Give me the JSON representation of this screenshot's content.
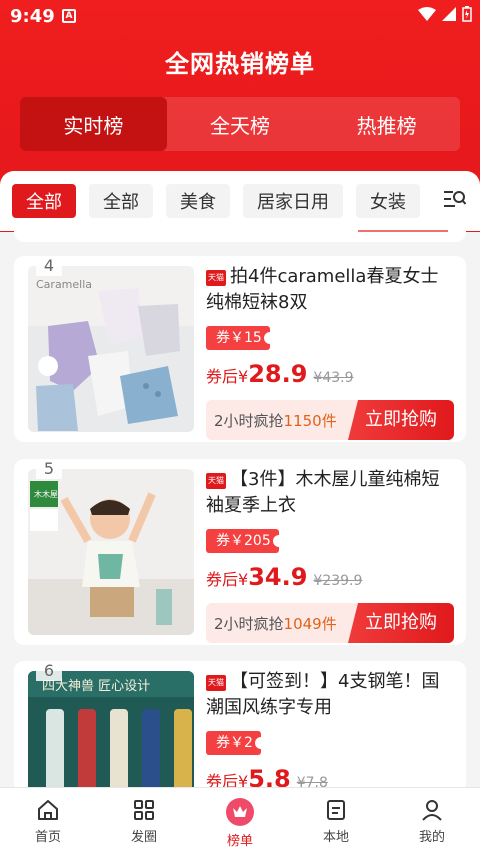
{
  "status": {
    "time": "9:49",
    "notif": "A"
  },
  "page": {
    "title": "全网热销榜单"
  },
  "tabs": [
    {
      "label": "实时榜",
      "active": true
    },
    {
      "label": "全天榜",
      "active": false
    },
    {
      "label": "热推榜",
      "active": false
    }
  ],
  "categories": [
    {
      "label": "全部",
      "active": true
    },
    {
      "label": "全部",
      "active": false
    },
    {
      "label": "美食",
      "active": false
    },
    {
      "label": "居家日用",
      "active": false
    },
    {
      "label": "女装",
      "active": false
    }
  ],
  "products": [
    {
      "rank": "4",
      "title": "拍4件caramella春夏女士纯棉短袜8双",
      "coupon": "券￥15",
      "price_label": "券后¥",
      "price": "28.9",
      "orig_price": "¥43.9",
      "sold_prefix": "2小时疯抢",
      "sold_count": "1150件",
      "buy_label": "立即抢购",
      "brand_text": "Caramella"
    },
    {
      "rank": "5",
      "title": "【3件】木木屋儿童纯棉短袖夏季上衣",
      "coupon": "券￥205",
      "price_label": "券后¥",
      "price": "34.9",
      "orig_price": "¥239.9",
      "sold_prefix": "2小时疯抢",
      "sold_count": "1049件",
      "buy_label": "立即抢购",
      "brand_text": "木木屋"
    },
    {
      "rank": "6",
      "title": "【可签到！】4支钢笔！国潮国风练字专用",
      "coupon": "券￥2",
      "price_label": "券后¥",
      "price": "5.8",
      "orig_price": "¥7.8",
      "banner_text": "四大神兽  匠心设计"
    }
  ],
  "badge": {
    "tmall": "天猫"
  },
  "nav": [
    {
      "label": "首页",
      "icon": "home-icon"
    },
    {
      "label": "发圈",
      "icon": "grid-icon"
    },
    {
      "label": "榜单",
      "icon": "crown-icon",
      "active": true
    },
    {
      "label": "本地",
      "icon": "document-icon"
    },
    {
      "label": "我的",
      "icon": "user-icon"
    }
  ],
  "colors": {
    "brand_red": "#e0191c",
    "coupon_red": "#f44040",
    "sold_highlight": "#e0631c"
  }
}
